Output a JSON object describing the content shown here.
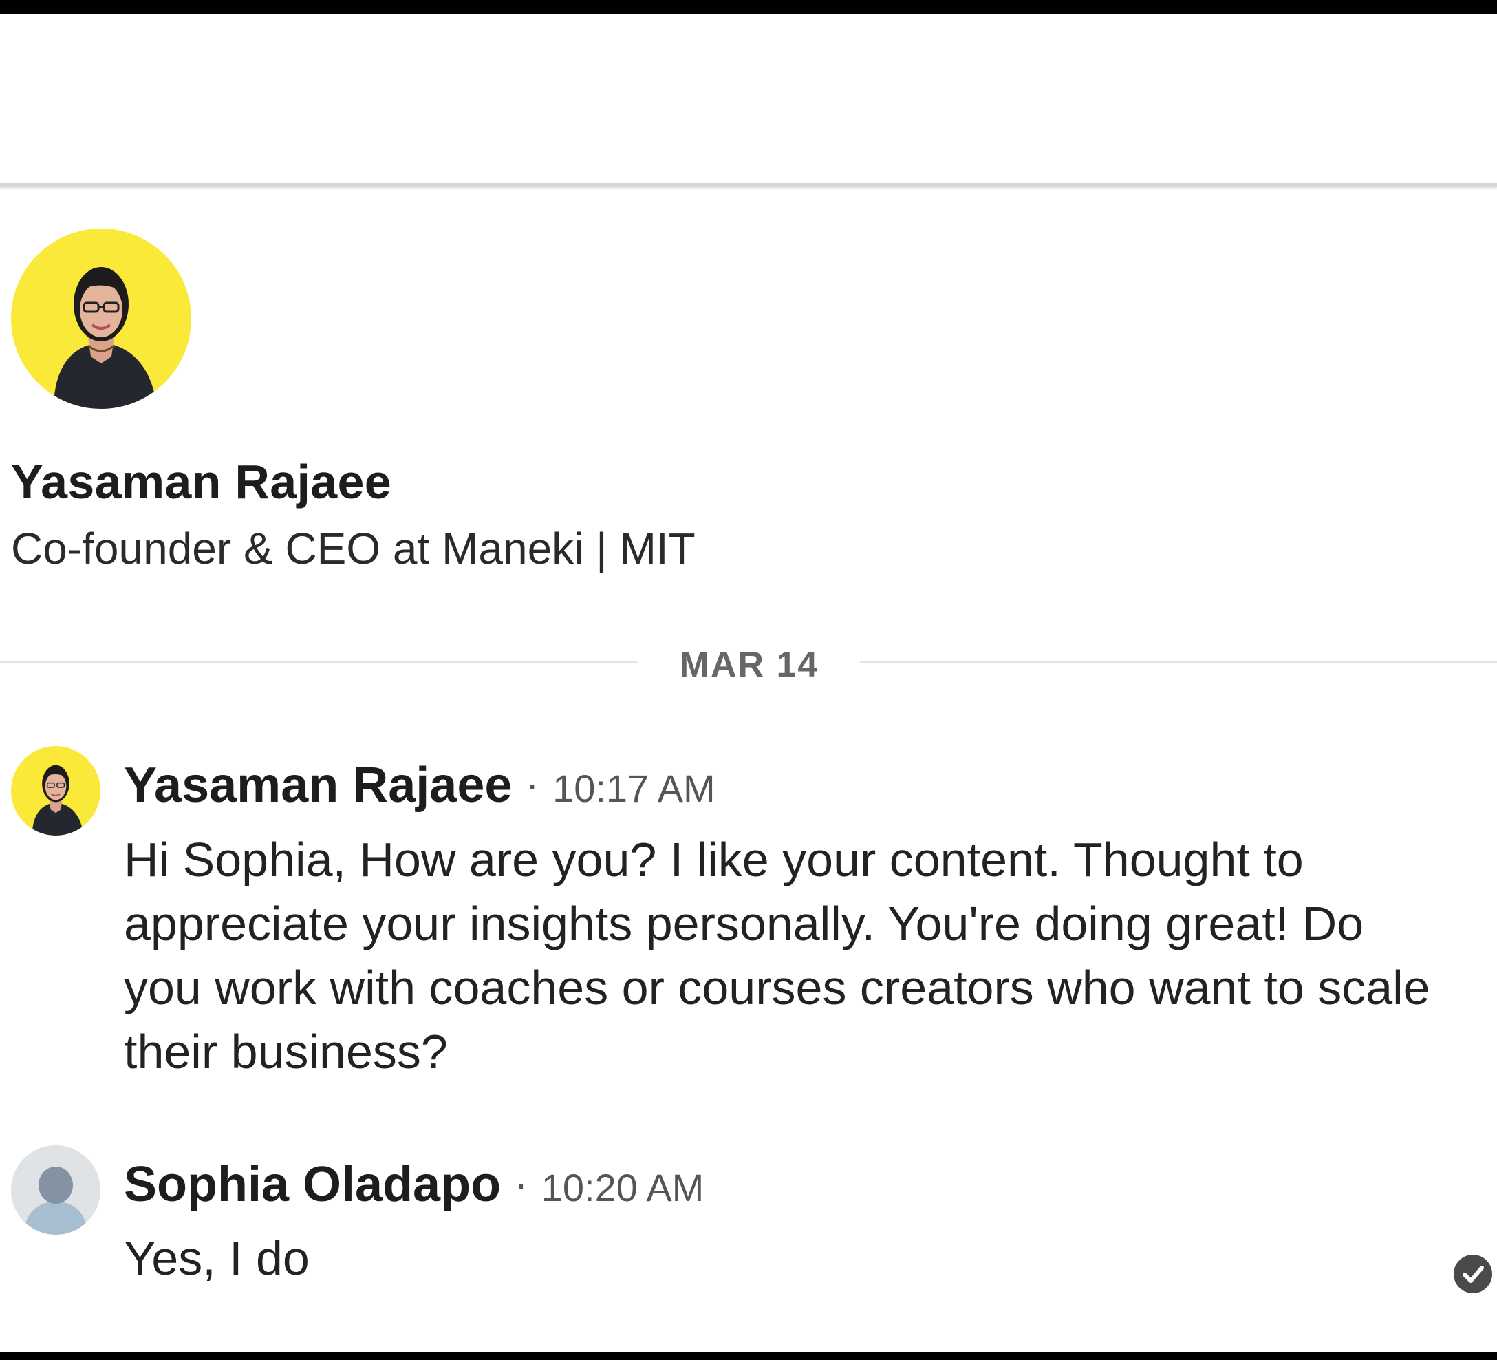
{
  "profile": {
    "name": "Yasaman Rajaee",
    "headline": "Co-founder & CEO at Maneki | MIT",
    "avatar_bg": "#fbe93a"
  },
  "conversation": {
    "date_divider": "MAR 14",
    "messages": [
      {
        "sender": "Yasaman Rajaee",
        "separator": "·",
        "time": "10:17 AM",
        "text": "Hi Sophia, How are you? I like your content. Thought to appreciate your insights personally. You're doing great! Do you work with coaches or courses creators who want to scale their business?",
        "avatar": "profile-photo"
      },
      {
        "sender": "Sophia Oladapo",
        "separator": "·",
        "time": "10:20 AM",
        "text": "Yes, I do",
        "avatar": "default-person-avatar",
        "status_icon": "read-check-icon"
      }
    ]
  }
}
